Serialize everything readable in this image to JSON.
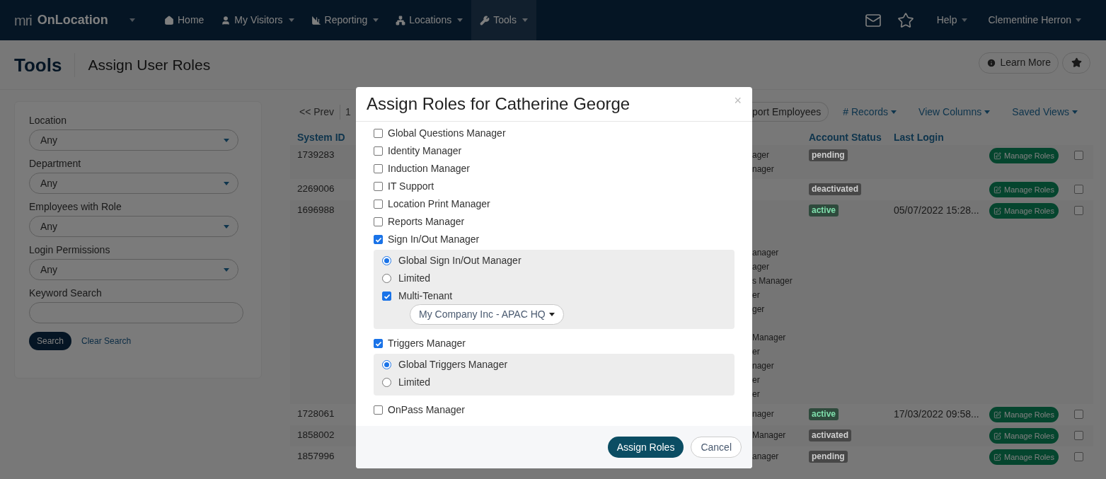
{
  "nav": {
    "logo_mark": "mri",
    "brand": "OnLocation",
    "items": [
      {
        "label": "Home",
        "dropdown": false,
        "selected": false
      },
      {
        "label": "My Visitors",
        "dropdown": true,
        "selected": false
      },
      {
        "label": "Reporting",
        "dropdown": true,
        "selected": false
      },
      {
        "label": "Locations",
        "dropdown": true,
        "selected": false
      },
      {
        "label": "Tools",
        "dropdown": true,
        "selected": true
      }
    ],
    "help": "Help",
    "user": "Clementine Herron"
  },
  "page_header": {
    "section": "Tools",
    "title": "Assign User Roles",
    "learn_more": "Learn More"
  },
  "filters": [
    {
      "kind": "select",
      "label": "Location",
      "value": "Any"
    },
    {
      "kind": "select",
      "label": "Department",
      "value": "Any"
    },
    {
      "kind": "select",
      "label": "Employees with Role",
      "value": "Any"
    },
    {
      "kind": "select",
      "label": "Login Permissions",
      "value": "Any"
    },
    {
      "kind": "text",
      "label": "Keyword Search"
    }
  ],
  "search_button": "Search",
  "clear_search": "Clear Search",
  "toolbar": {
    "prev": "<< Prev",
    "page": "1",
    "export": "port Employees",
    "records": "# Records",
    "view_columns": "View Columns",
    "saved_views": "Saved Views"
  },
  "table": {
    "columns": [
      "System ID",
      "Account Status",
      "Last Login"
    ],
    "rows": [
      {
        "id": "1739283",
        "roles": [
          "ager",
          "nager"
        ],
        "status": "pending",
        "color": "#474747",
        "action": "Manage Roles",
        "checked": false
      },
      {
        "id": "2269006",
        "status": "deactivated",
        "color": "#474747",
        "action": "Manage Roles",
        "checked": false
      },
      {
        "id": "1696988",
        "roles": [
          "anager",
          "ager",
          "s Manager",
          "er",
          "ger",
          "Manager",
          "er",
          "nager",
          "er",
          "er"
        ],
        "status": "active",
        "color": "#2e4a3c",
        "last_login": "05/07/2022 15:28...",
        "action": "Manage Roles",
        "checked": false
      },
      {
        "id": "1728061",
        "roles": [
          "nager"
        ],
        "status": "active",
        "color": "#2e4a3c",
        "last_login": "17/03/2022 09:58...",
        "action": "Manage Roles",
        "checked": false
      },
      {
        "id": "1858002",
        "roles": [
          "Manager"
        ],
        "status": "activated",
        "color": "#474747",
        "action": "Manage Roles",
        "checked": false
      },
      {
        "id": "1857996",
        "roles": [
          "anager"
        ],
        "status": "pending",
        "color": "#474747",
        "action": "Manage Roles",
        "checked": false
      }
    ]
  },
  "modal": {
    "title": "Assign Roles for Catherine George",
    "close": "×",
    "roles": [
      {
        "label": "Global Questions Manager",
        "checked": false
      },
      {
        "label": "Identity Manager",
        "checked": false
      },
      {
        "label": "Induction Manager",
        "checked": false
      },
      {
        "label": "IT Support",
        "checked": false
      },
      {
        "label": "Location Print Manager",
        "checked": false
      },
      {
        "label": "Reports Manager",
        "checked": false
      },
      {
        "label": "Sign In/Out Manager",
        "checked": true,
        "options": [
          {
            "kind": "radio",
            "label": "Global Sign In/Out Manager",
            "selected": true
          },
          {
            "kind": "radio",
            "label": "Limited",
            "selected": false
          },
          {
            "kind": "checkbox",
            "label": "Multi-Tenant",
            "checked": true,
            "dropdown": "My Company Inc - APAC HQ"
          }
        ]
      },
      {
        "label": "Triggers Manager",
        "checked": true,
        "options": [
          {
            "kind": "radio",
            "label": "Global Triggers Manager",
            "selected": true
          },
          {
            "kind": "radio",
            "label": "Limited",
            "selected": false
          }
        ]
      },
      {
        "label": "OnPass Manager",
        "checked": false
      }
    ],
    "buttons": [
      {
        "kind": "primary",
        "label": "Assign Roles"
      },
      {
        "kind": "secondary",
        "label": "Cancel"
      }
    ]
  }
}
